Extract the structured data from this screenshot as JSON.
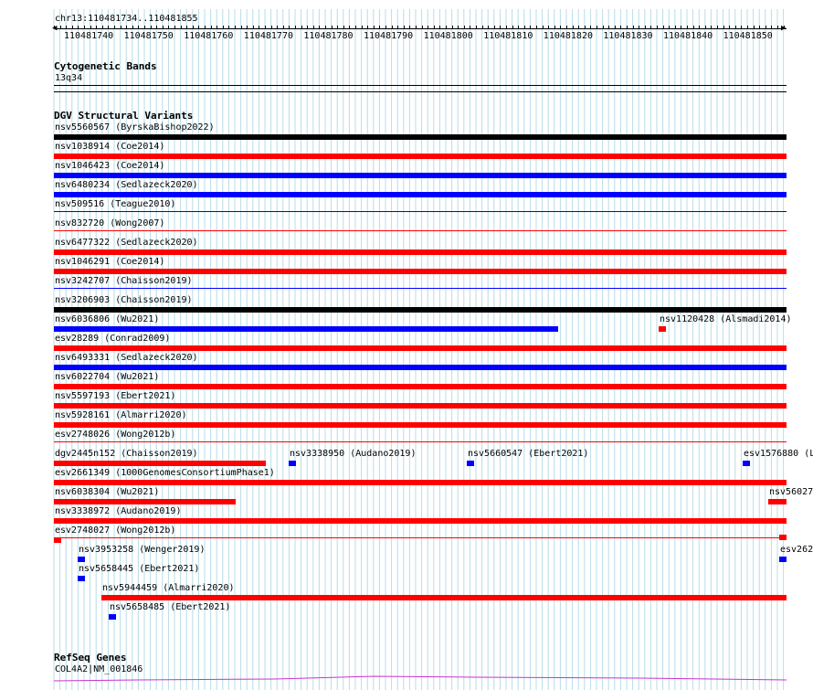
{
  "ruler": {
    "location": "chr13:110481734..110481855",
    "tick_labels": [
      "110481740",
      "110481750",
      "110481760",
      "110481770",
      "110481780",
      "110481790",
      "110481800",
      "110481810",
      "110481820",
      "110481830",
      "110481840",
      "110481850"
    ]
  },
  "cytoband": {
    "title": "Cytogenetic Bands",
    "band": "13q34"
  },
  "dgv": {
    "title": "DGV Structural Variants",
    "features": [
      {
        "label": "nsv5560567 (ByrskaBishop2022)",
        "color": "#000000",
        "row": 0,
        "start": 0,
        "end": 1
      },
      {
        "label": "nsv1038914 (Coe2014)",
        "color": "#ff0000",
        "row": 1,
        "start": 0,
        "end": 1
      },
      {
        "label": "nsv1046423 (Coe2014)",
        "color": "#0000ff",
        "row": 2,
        "start": 0,
        "end": 1
      },
      {
        "label": "nsv6480234 (Sedlazeck2020)",
        "color": "#0000ff",
        "row": 3,
        "start": 0,
        "end": 1
      },
      {
        "label": "nsv509516 (Teague2010)",
        "color": "#0000ff",
        "row": 4,
        "start": 0,
        "end": 1,
        "thin": true
      },
      {
        "label": "nsv832720 (Wong2007)",
        "color": "#ff0000",
        "row": 5,
        "start": 0,
        "end": 1,
        "thin": true
      },
      {
        "label": "nsv6477322 (Sedlazeck2020)",
        "color": "#ff0000",
        "row": 6,
        "start": 0,
        "end": 1
      },
      {
        "label": "nsv1046291 (Coe2014)",
        "color": "#ff0000",
        "row": 7,
        "start": 0,
        "end": 1
      },
      {
        "label": "nsv3242707 (Chaisson2019)",
        "color": "#0000ff",
        "row": 8,
        "start": 0,
        "end": 1,
        "thin": true
      },
      {
        "label": "nsv3206903 (Chaisson2019)",
        "color": "#000000",
        "row": 9,
        "start": 0,
        "end": 1
      },
      {
        "label": "nsv6036806 (Wu2021)",
        "color": "#0000ff",
        "row": 10,
        "start": 0,
        "end": 0.688
      },
      {
        "label": "nsv1120428 (Alsmadi2014)",
        "color": "#ff0000",
        "row": 10,
        "start": 0.825,
        "end": 0.835
      },
      {
        "label": "esv28289 (Conrad2009)",
        "color": "#ff0000",
        "row": 11,
        "start": 0,
        "end": 1
      },
      {
        "label": "nsv6493331 (Sedlazeck2020)",
        "color": "#0000ff",
        "row": 12,
        "start": 0,
        "end": 1
      },
      {
        "label": "nsv6022704 (Wu2021)",
        "color": "#ff0000",
        "row": 13,
        "start": 0,
        "end": 1
      },
      {
        "label": "nsv5597193 (Ebert2021)",
        "color": "#ff0000",
        "row": 14,
        "start": 0,
        "end": 1
      },
      {
        "label": "nsv5928161 (Almarri2020)",
        "color": "#ff0000",
        "row": 15,
        "start": 0,
        "end": 1
      },
      {
        "label": "esv2748026 (Wong2012b)",
        "color": "#ff0000",
        "row": 16,
        "start": 0,
        "end": 1,
        "thin": true
      },
      {
        "label": "dgv2445n152 (Chaisson2019)",
        "color": "#ff0000",
        "row": 17,
        "start": 0,
        "end": 0.289
      },
      {
        "label": "nsv3338950 (Audano2019)",
        "color": "#0000ff",
        "row": 17,
        "start": 0.32,
        "end": 0.33
      },
      {
        "label": "nsv5660547 (Ebert2021)",
        "color": "#0000ff",
        "row": 17,
        "start": 0.564,
        "end": 0.574
      },
      {
        "label": "esv1576880 (L",
        "color": "#0000ff",
        "row": 17,
        "start": 0.94,
        "end": 0.95
      },
      {
        "label": "esv2661349 (1000GenomesConsortiumPhase1)",
        "color": "#ff0000",
        "row": 18,
        "start": 0,
        "end": 1
      },
      {
        "label": "nsv6038304 (Wu2021)",
        "color": "#ff0000",
        "row": 19,
        "start": 0,
        "end": 0.248
      },
      {
        "label": "nsv560273",
        "color": "#ff0000",
        "row": 19,
        "start": 0.975,
        "end": 1
      },
      {
        "label": "nsv3338972 (Audano2019)",
        "color": "#ff0000",
        "row": 20,
        "start": 0,
        "end": 1
      },
      {
        "label": "esv2748027 (Wong2012b)",
        "color": "#ff0000",
        "row": 21,
        "start": 0,
        "end": 0.01,
        "thin_tail": true
      },
      {
        "label": "nsv3953258 (Wenger2019)",
        "color": "#0000ff",
        "row": 22,
        "start": 0.033,
        "end": 0.043
      },
      {
        "label": "esv262",
        "color": "#0000ff",
        "row": 22,
        "start": 0.99,
        "end": 1
      },
      {
        "label": "nsv5658445 (Ebert2021)",
        "color": "#0000ff",
        "row": 23,
        "start": 0.033,
        "end": 0.043
      },
      {
        "label": "nsv5944459 (Almarri2020)",
        "color": "#ff0000",
        "row": 24,
        "start": 0.065,
        "end": 1
      },
      {
        "label": "nsv5658485 (Ebert2021)",
        "color": "#0000ff",
        "row": 25,
        "start": 0.075,
        "end": 0.085
      }
    ]
  },
  "refseq": {
    "title": "RefSeq Genes",
    "gene": "COL4A2|NM_001846",
    "color": "#cc33cc"
  }
}
